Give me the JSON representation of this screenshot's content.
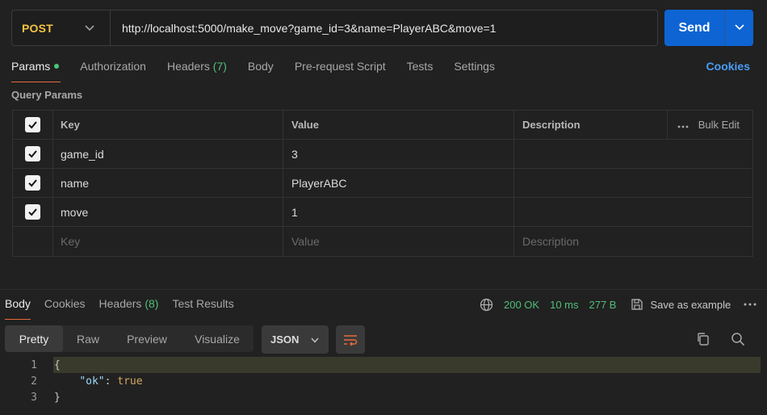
{
  "request": {
    "method": "POST",
    "url": "http://localhost:5000/make_move?game_id=3&name=PlayerABC&move=1",
    "send_label": "Send"
  },
  "tabs": [
    {
      "label": "Params",
      "active": true,
      "dot": true
    },
    {
      "label": "Authorization"
    },
    {
      "label": "Headers",
      "count": "(7)"
    },
    {
      "label": "Body"
    },
    {
      "label": "Pre-request Script"
    },
    {
      "label": "Tests"
    },
    {
      "label": "Settings"
    }
  ],
  "cookies_link": "Cookies",
  "query_params": {
    "title": "Query Params",
    "headers": {
      "key": "Key",
      "value": "Value",
      "description": "Description",
      "bulk_edit": "Bulk Edit"
    },
    "rows": [
      {
        "key": "game_id",
        "value": "3",
        "description": "",
        "checked": true
      },
      {
        "key": "name",
        "value": "PlayerABC",
        "description": "",
        "checked": true
      },
      {
        "key": "move",
        "value": "1",
        "description": "",
        "checked": true
      }
    ],
    "placeholder": {
      "key": "Key",
      "value": "Value",
      "description": "Description"
    }
  },
  "response": {
    "tabs": [
      {
        "label": "Body",
        "active": true
      },
      {
        "label": "Cookies"
      },
      {
        "label": "Headers",
        "count": "(8)"
      },
      {
        "label": "Test Results"
      }
    ],
    "status": "200 OK",
    "time": "10 ms",
    "size": "277 B",
    "save_example": "Save as example",
    "views": [
      "Pretty",
      "Raw",
      "Preview",
      "Visualize"
    ],
    "active_view": "Pretty",
    "format": "JSON",
    "code": {
      "line_numbers": [
        "1",
        "2",
        "3"
      ],
      "open_brace": "{",
      "key": "\"ok\"",
      "colon": ": ",
      "value": "true",
      "close_brace": "}"
    }
  },
  "colors": {
    "method": "#f4c542",
    "send": "#0e64d2",
    "accent": "#e8693a",
    "success": "#4fbf7a",
    "link": "#4a9df5"
  },
  "icons": [
    "chevron-down-icon",
    "check-icon",
    "ellipsis-icon",
    "globe-icon",
    "save-icon",
    "more-icon",
    "wrap-lines-icon",
    "copy-icon",
    "search-icon"
  ]
}
